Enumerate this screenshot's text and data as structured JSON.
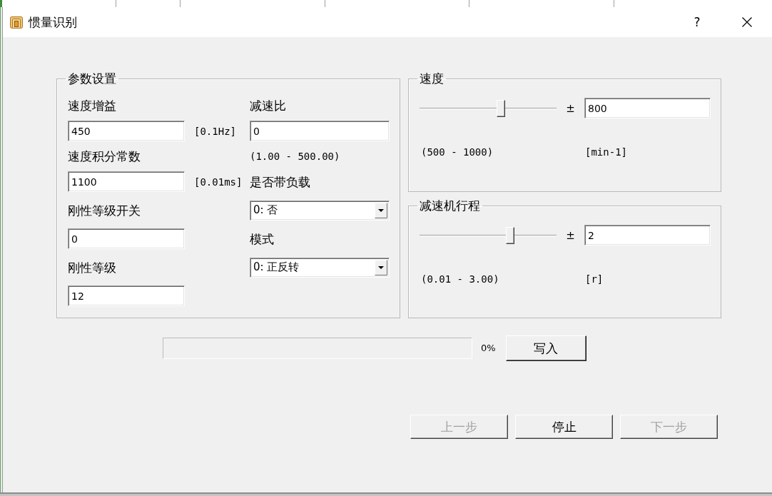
{
  "window": {
    "title": "惯量识别",
    "help": "?"
  },
  "parameters": {
    "title": "参数设置",
    "left_fields": [
      {
        "label": "速度增益",
        "kind": "text",
        "value": "450",
        "unit": "[0.1Hz]"
      },
      {
        "label": "速度积分常数",
        "kind": "text",
        "value": "1100",
        "unit": "[0.01ms]"
      },
      {
        "label": "刚性等级开关",
        "kind": "text",
        "value": "0"
      },
      {
        "label": "刚性等级",
        "kind": "text",
        "value": "12"
      }
    ],
    "right_fields": [
      {
        "label": "减速比",
        "kind": "text",
        "value": "0",
        "hint": "(1.00 - 500.00)"
      },
      {
        "label": "是否带负载",
        "kind": "select",
        "value": "0: 否"
      },
      {
        "label": "模式",
        "kind": "select",
        "value": "0: 正反转"
      }
    ]
  },
  "slider_groups": [
    {
      "title": "速度",
      "level": 0.6,
      "sign": "±",
      "value": "800",
      "range": "(500 - 1000)",
      "unit": "[min-1]"
    },
    {
      "title": "减速机行程",
      "level": 0.67,
      "sign": "±",
      "value": "2",
      "range": "(0.01 - 3.00)",
      "unit": "[r]"
    }
  ],
  "write": {
    "level": 0,
    "reading": "0%",
    "button": "写入"
  },
  "nav_buttons": [
    {
      "label": "上一步",
      "disabled": true
    },
    {
      "label": "停止",
      "disabled": false
    },
    {
      "label": "下一步",
      "disabled": true
    }
  ]
}
